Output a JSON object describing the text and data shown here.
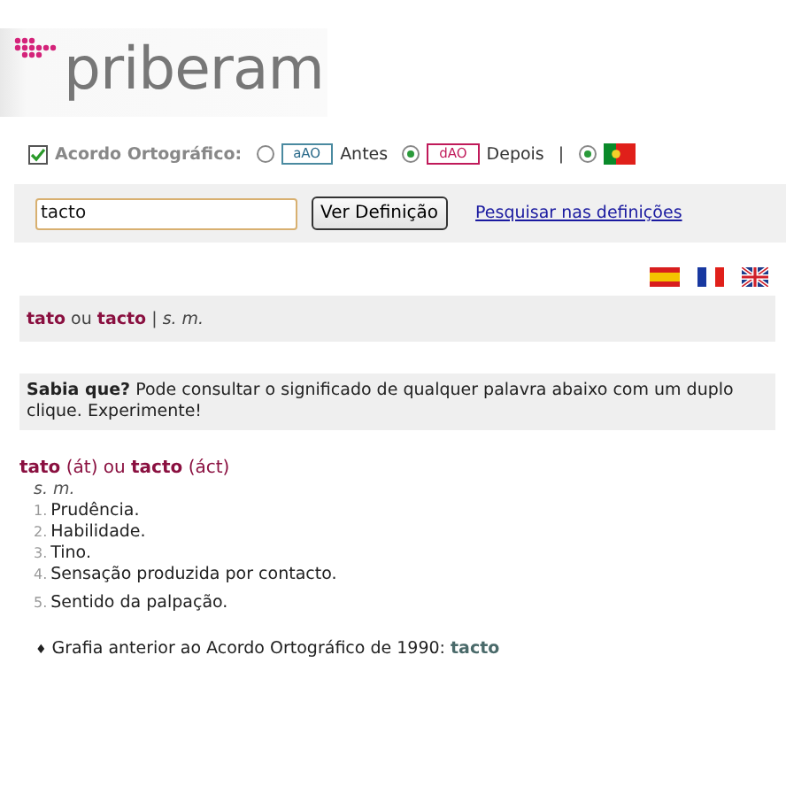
{
  "logo": {
    "text": "priberam"
  },
  "options": {
    "checkbox": {
      "label": "Acordo Ortográfico:",
      "checked": true
    },
    "radios": [
      {
        "tag": "aAO",
        "label": "Antes",
        "selected": false,
        "kind": "before"
      },
      {
        "tag": "dAO",
        "label": "Depois",
        "selected": true,
        "kind": "after"
      }
    ],
    "separator": "|",
    "flag_radio": {
      "selected": true
    }
  },
  "search": {
    "value": "tacto",
    "button": "Ver Definição",
    "link": "Pesquisar nas definições"
  },
  "header": "**tato** ou **tacto** | *s. m.*",
  "tip": "**Sabia que?** Pode consultar o significado de qualquer palavra abaixo com um duplo clique. Experimente!",
  "entry": {
    "headword": "**tato** (át) ou **tacto** (áct)",
    "class": "s. m.",
    "senses": [
      {
        "number": "1.",
        "text": "Prudência."
      },
      {
        "number": "2.",
        "text": "Habilidade."
      },
      {
        "number": "3.",
        "text": "Tino."
      },
      {
        "number": "4.",
        "text": "Sensação produzida por contacto."
      },
      {
        "number": "5.",
        "text": "Sentido da palpação."
      }
    ]
  },
  "note": {
    "bullet": "♦",
    "text": "Grafia anterior ao Acordo Ortográfico de 1990:",
    "word": "tacto"
  }
}
